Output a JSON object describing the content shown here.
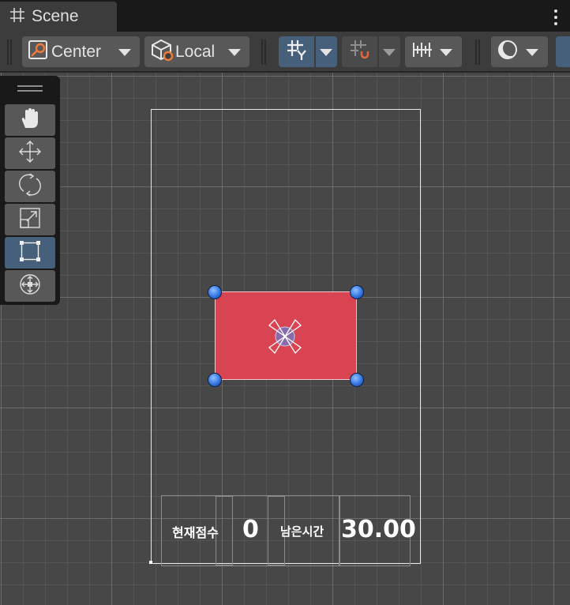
{
  "window": {
    "tab_title": "Scene",
    "tab_icon": "hash-grid-icon"
  },
  "toolbar": {
    "pivot_mode_label": "Center",
    "pivot_rotation_label": "Local",
    "pivot_mode_icon": "pivot-center-icon",
    "pivot_rotation_icon": "local-cube-icon",
    "grid_toggle_icon": "grid-y-icon",
    "snap_icon": "grid-snap-magnet-icon",
    "increment_snap_icon": "increment-snap-ruler-icon",
    "render_mode_icon": "shading-sphere-icon"
  },
  "tools": [
    {
      "name": "hand-tool",
      "icon": "hand-icon",
      "active": false
    },
    {
      "name": "move-tool",
      "icon": "move-arrows-icon",
      "active": false
    },
    {
      "name": "rotate-tool",
      "icon": "rotate-icon",
      "active": false
    },
    {
      "name": "scale-tool",
      "icon": "scale-icon",
      "active": false
    },
    {
      "name": "rect-tool",
      "icon": "rect-transform-icon",
      "active": true
    },
    {
      "name": "transform-tool",
      "icon": "transform-icon",
      "active": false
    }
  ],
  "hud": {
    "score_label": "현재점수",
    "score_value": "0",
    "time_label": "남은시간",
    "time_value": "30.00"
  },
  "colors": {
    "selected_object": "#d94452",
    "handle": "#2f6fde",
    "active_tool": "#46607c",
    "scene_background": "#474747"
  }
}
